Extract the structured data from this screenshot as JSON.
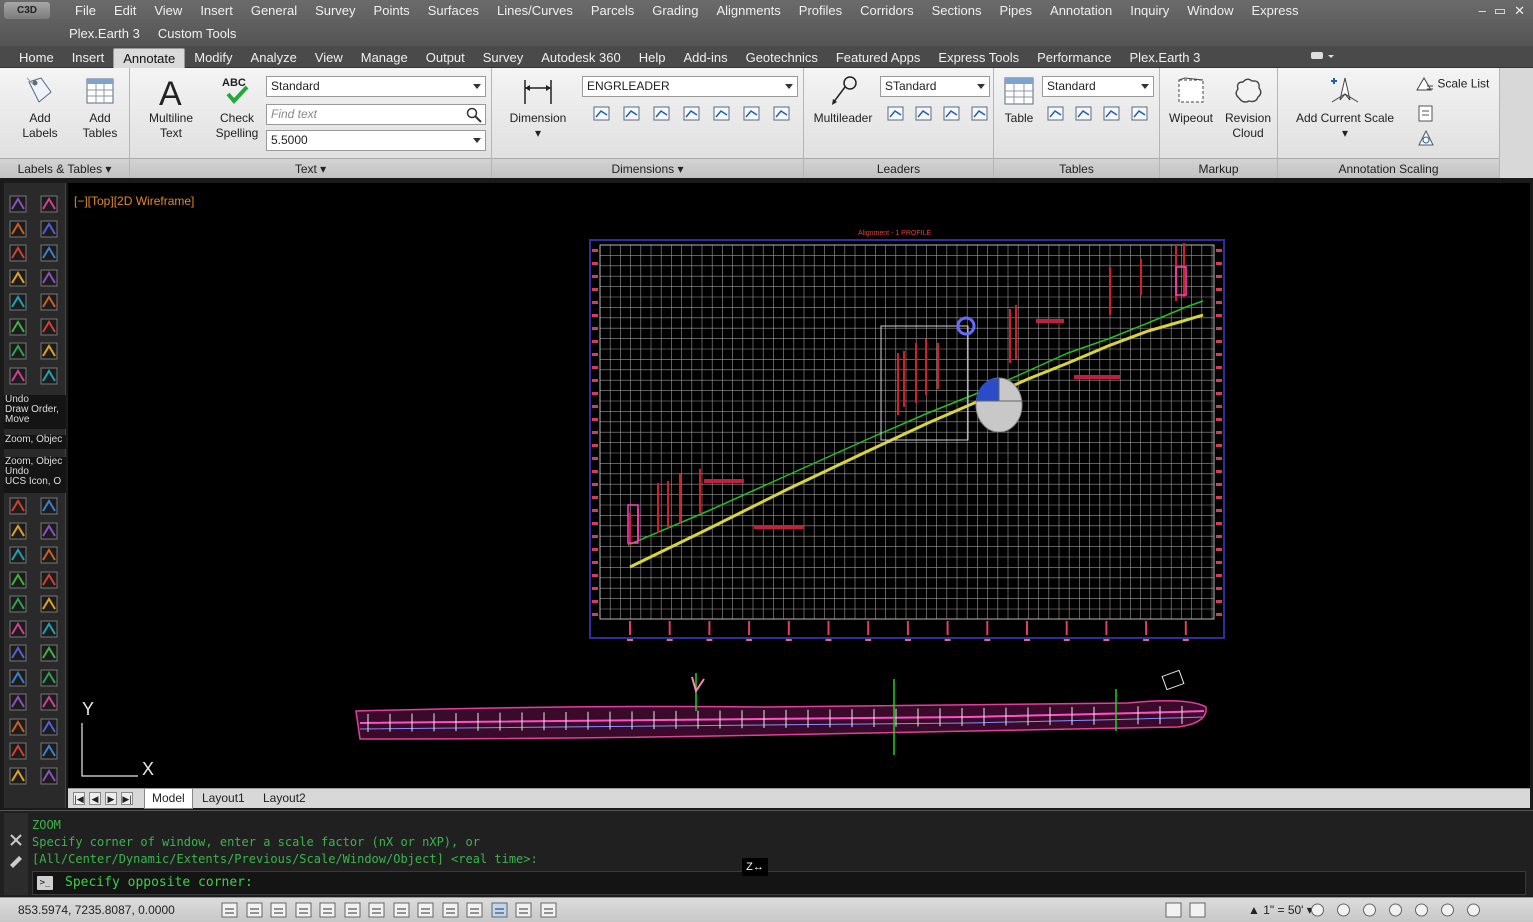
{
  "app": {
    "logo": "C3D",
    "menus": [
      "File",
      "Edit",
      "View",
      "Insert",
      "General",
      "Survey",
      "Points",
      "Surfaces",
      "Lines/Curves",
      "Parcels",
      "Grading",
      "Alignments",
      "Profiles",
      "Corridors",
      "Sections",
      "Pipes",
      "Annotation",
      "Inquiry",
      "Window",
      "Express"
    ],
    "menus2": [
      "Plex.Earth 3",
      "Custom Tools"
    ],
    "win_controls": [
      "–",
      "▭",
      "✕"
    ]
  },
  "ribbon_tabs": [
    "Home",
    "Insert",
    "Annotate",
    "Modify",
    "Analyze",
    "View",
    "Manage",
    "Output",
    "Survey",
    "Autodesk 360",
    "Help",
    "Add-ins",
    "Geotechnics",
    "Featured Apps",
    "Express Tools",
    "Performance",
    "Plex.Earth 3"
  ],
  "active_tab": "Annotate",
  "panels": {
    "labels_tables": {
      "title": "Labels & Tables",
      "add_labels": [
        "Add",
        "Labels"
      ],
      "add_tables": [
        "Add",
        "Tables"
      ]
    },
    "text": {
      "title": "Text",
      "multiline": [
        "Multiline",
        "Text"
      ],
      "check": [
        "Check",
        "Spelling"
      ],
      "style_value": "Standard",
      "find_placeholder": "Find text",
      "height_value": "5.5000",
      "abc": "ABC"
    },
    "dimensions": {
      "title": "Dimensions",
      "dimension_label": "Dimension",
      "style_value": "ENGRLEADER"
    },
    "leaders": {
      "title": "Leaders",
      "multileader_label": "Multileader",
      "style_value": "STandard"
    },
    "tables": {
      "title": "Tables",
      "table_label": "Table",
      "style_value": "Standard"
    },
    "markup": {
      "title": "Markup",
      "wipeout": "Wipeout",
      "revision": [
        "Revision",
        "Cloud"
      ]
    },
    "annotation_scaling": {
      "title": "Annotation Scaling",
      "add_current": "Add Current Scale",
      "scale_list": "Scale List"
    }
  },
  "tool_history": [
    [
      "Undo",
      "Draw Order,",
      "Move"
    ],
    [
      "Zoom, Objec"
    ],
    [
      "Zoom, Objec",
      "Undo",
      "UCS Icon, O"
    ]
  ],
  "viewport": {
    "label": "[−][Top][2D Wireframe]",
    "profile_title": "Alignment - 1 PROFILE",
    "ucs_y": "Y",
    "ucs_x": "X"
  },
  "layout_tabs": [
    "Model",
    "Layout1",
    "Layout2"
  ],
  "active_layout": "Model",
  "nav_buttons": [
    "|◀",
    "◀",
    "▶",
    "▶|"
  ],
  "command": {
    "history": [
      "ZOOM",
      "Specify corner of window, enter a scale factor (nX or nXP), or",
      "[All/Center/Dynamic/Extents/Previous/Scale/Window/Object] <real time>:"
    ],
    "prompt": "Specify opposite corner:",
    "prompt_icon": ">_",
    "cursor_glyph": "Z↔"
  },
  "status": {
    "coords": "853.5974, 7235.8087, 0.0000",
    "scale": "1\" = 50'"
  },
  "colors": {
    "viewport_bg": "#000000",
    "grid": "#8a8a8a",
    "ground_line": "#22c022",
    "design_line": "#d6d63a",
    "tick_red": "#d0202a",
    "command_text": "#39b54a"
  }
}
